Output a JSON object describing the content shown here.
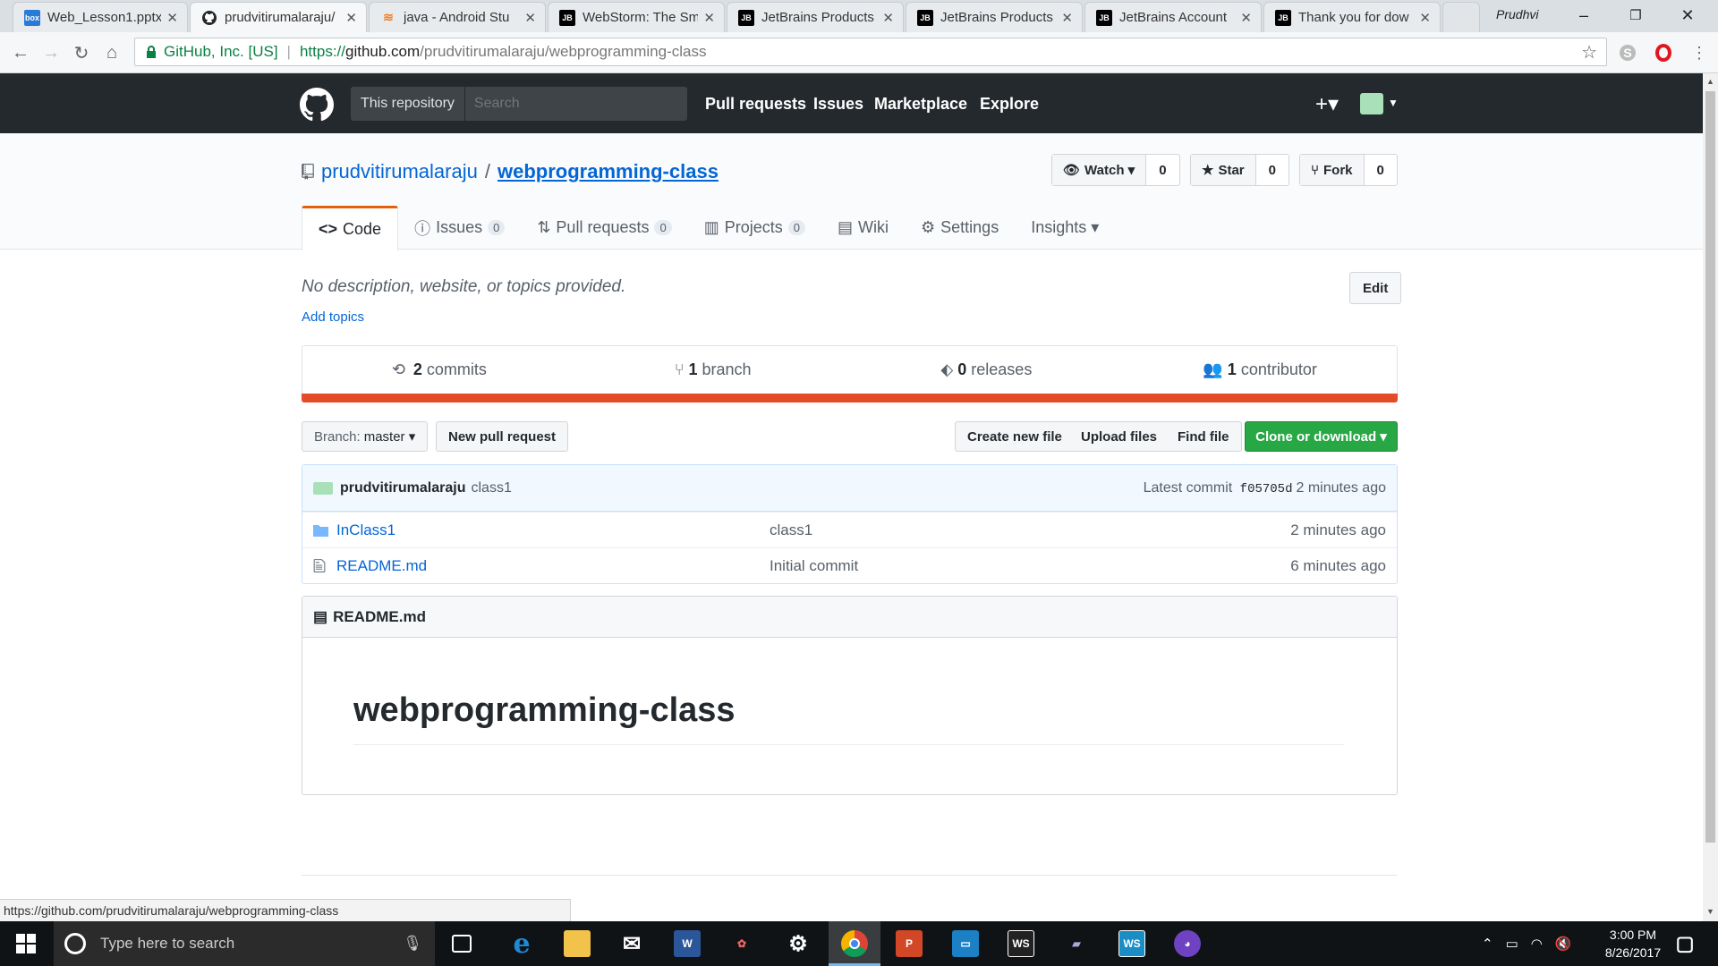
{
  "browser": {
    "tabs": [
      {
        "title": "Web_Lesson1.pptx",
        "icon": "box-icon",
        "fav": "box",
        "color": "#2a7bd5"
      },
      {
        "title": "prudvitirumalaraju/",
        "icon": "github-icon",
        "fav": "",
        "color": "#24292e",
        "active": true
      },
      {
        "title": "java - Android Stu",
        "icon": "stackoverflow-icon",
        "fav": "",
        "color": "#f48024"
      },
      {
        "title": "WebStorm: The Sm",
        "icon": "jetbrains-icon",
        "fav": "JB",
        "color": "#000000"
      },
      {
        "title": "JetBrains Products",
        "icon": "jetbrains-icon",
        "fav": "JB",
        "color": "#000000"
      },
      {
        "title": "JetBrains Products",
        "icon": "jetbrains-icon",
        "fav": "JB",
        "color": "#000000"
      },
      {
        "title": "JetBrains Account",
        "icon": "jetbrains-icon",
        "fav": "JB",
        "color": "#000000"
      },
      {
        "title": "Thank you for dow",
        "icon": "jetbrains-icon",
        "fav": "JB",
        "color": "#000000"
      }
    ],
    "profile_name": "Prudhvi",
    "secure_label": "GitHub, Inc. [US]",
    "url_scheme": "https://",
    "url_domain": "github.com",
    "url_path": "/prudvitirumalaraju/webprogramming-class",
    "status_url": "https://github.com/prudvitirumalaraju/webprogramming-class"
  },
  "header": {
    "scope": "This repository",
    "search_placeholder": "Search",
    "nav": [
      "Pull requests",
      "Issues",
      "Marketplace",
      "Explore"
    ],
    "plus": "+▾"
  },
  "repo": {
    "owner": "prudvitirumalaraju",
    "separator": "/",
    "name": "webprogramming-class",
    "watch_label": "Watch ▾",
    "watch_count": "0",
    "star_label": "Star",
    "star_count": "0",
    "fork_label": "Fork",
    "fork_count": "0",
    "tabs": {
      "code": "Code",
      "issues": "Issues",
      "issues_count": "0",
      "pulls": "Pull requests",
      "pulls_count": "0",
      "projects": "Projects",
      "projects_count": "0",
      "wiki": "Wiki",
      "settings": "Settings",
      "insights": "Insights ▾"
    },
    "description": "No description, website, or topics provided.",
    "add_topics": "Add topics",
    "edit_label": "Edit",
    "summary": {
      "commits_num": "2",
      "commits_label": "commits",
      "branch_num": "1",
      "branch_label": "branch",
      "releases_num": "0",
      "releases_label": "releases",
      "contributor_num": "1",
      "contributor_label": "contributor"
    },
    "language_color": "#e34c26",
    "branch_prefix": "Branch:",
    "branch_name": "master ▾",
    "new_pr": "New pull request",
    "create_file": "Create new file",
    "upload_files": "Upload files",
    "find_file": "Find file",
    "clone": "Clone or download ▾",
    "commit": {
      "author": "prudvitirumalaraju",
      "message": "class1",
      "latest_label": "Latest commit",
      "sha": "f05705d",
      "age": "2 minutes ago"
    },
    "files": [
      {
        "name": "InClass1",
        "type": "folder",
        "message": "class1",
        "age": "2 minutes ago"
      },
      {
        "name": "README.md",
        "type": "file",
        "message": "Initial commit",
        "age": "6 minutes ago"
      }
    ],
    "readme": {
      "title": "README.md",
      "heading": "webprogramming-class"
    }
  },
  "taskbar": {
    "search_placeholder": "Type here to search",
    "time": "3:00 PM",
    "date": "8/26/2017"
  }
}
